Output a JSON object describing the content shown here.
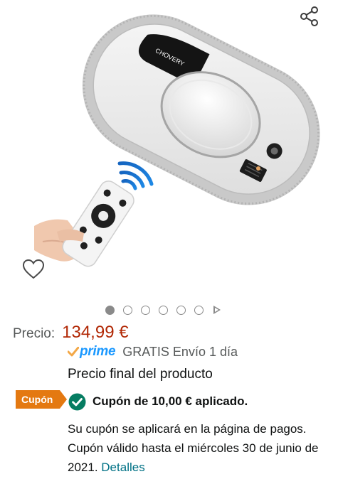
{
  "product_image": {
    "brand_on_device": "CHOVERY"
  },
  "icons": {
    "share": "share-icon",
    "wishlist": "heart-icon",
    "prime_check": "prime-check-icon",
    "coupon_check": "check-circle-icon"
  },
  "gallery": {
    "total_images": 6,
    "active_index": 0,
    "has_video": true
  },
  "price": {
    "label": "Precio:",
    "value": "134,99 €"
  },
  "delivery": {
    "prime_label": "prime",
    "text": "GRATIS Envío 1 día"
  },
  "final_price_note": "Precio final del producto",
  "coupon": {
    "badge": "Cupón",
    "applied_text": "Cupón de 10,00 € aplicado.",
    "note": "Su cupón se aplicará en la página de pagos. Cupón válido hasta el miércoles 30 de junio de 2021.",
    "details_link": "Detalles"
  },
  "colors": {
    "price": "#b12704",
    "prime": "#1a98ff",
    "coupon_badge": "#e47911",
    "check": "#067d62",
    "link": "#007185"
  }
}
